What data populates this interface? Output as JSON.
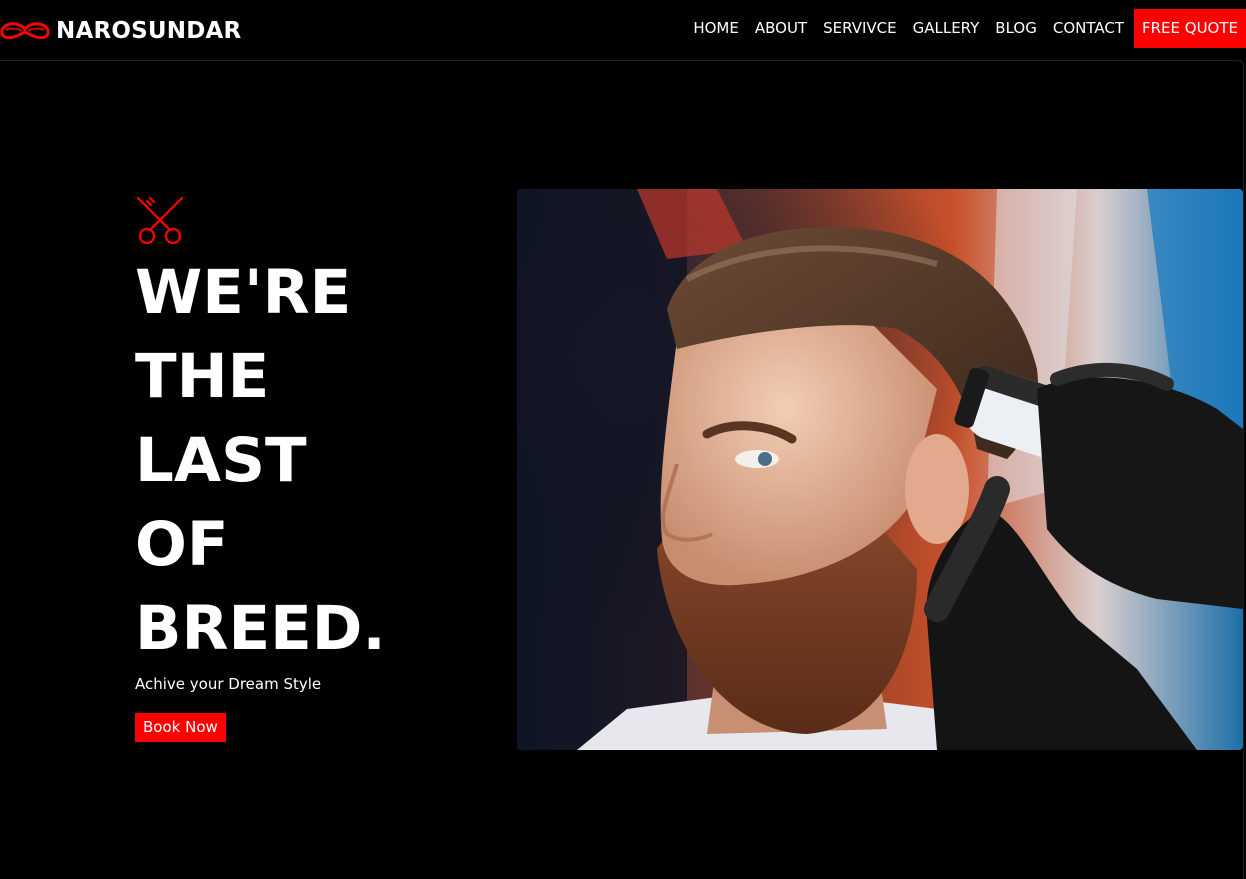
{
  "brand": {
    "name": "NAROSUNDAR",
    "logo_icon": "mustache-icon",
    "accent_color": "#ff0000"
  },
  "nav": {
    "items": [
      {
        "label": "HOME"
      },
      {
        "label": "ABOUT"
      },
      {
        "label": "SERVIVCE"
      },
      {
        "label": "GALLERY"
      },
      {
        "label": "BLOG"
      },
      {
        "label": "CONTACT"
      }
    ],
    "cta_label": "FREE QUOTE"
  },
  "hero": {
    "icon": "scissors-icon",
    "headline_lines": [
      "WE'RE",
      "THE",
      "LAST",
      "OF",
      "BREED."
    ],
    "tagline": "Achive your Dream Style",
    "button_label": "Book Now",
    "image": "barber-trimming-bearded-man-photo"
  },
  "colors": {
    "background": "#000000",
    "accent": "#ff0000",
    "text": "#ffffff"
  }
}
